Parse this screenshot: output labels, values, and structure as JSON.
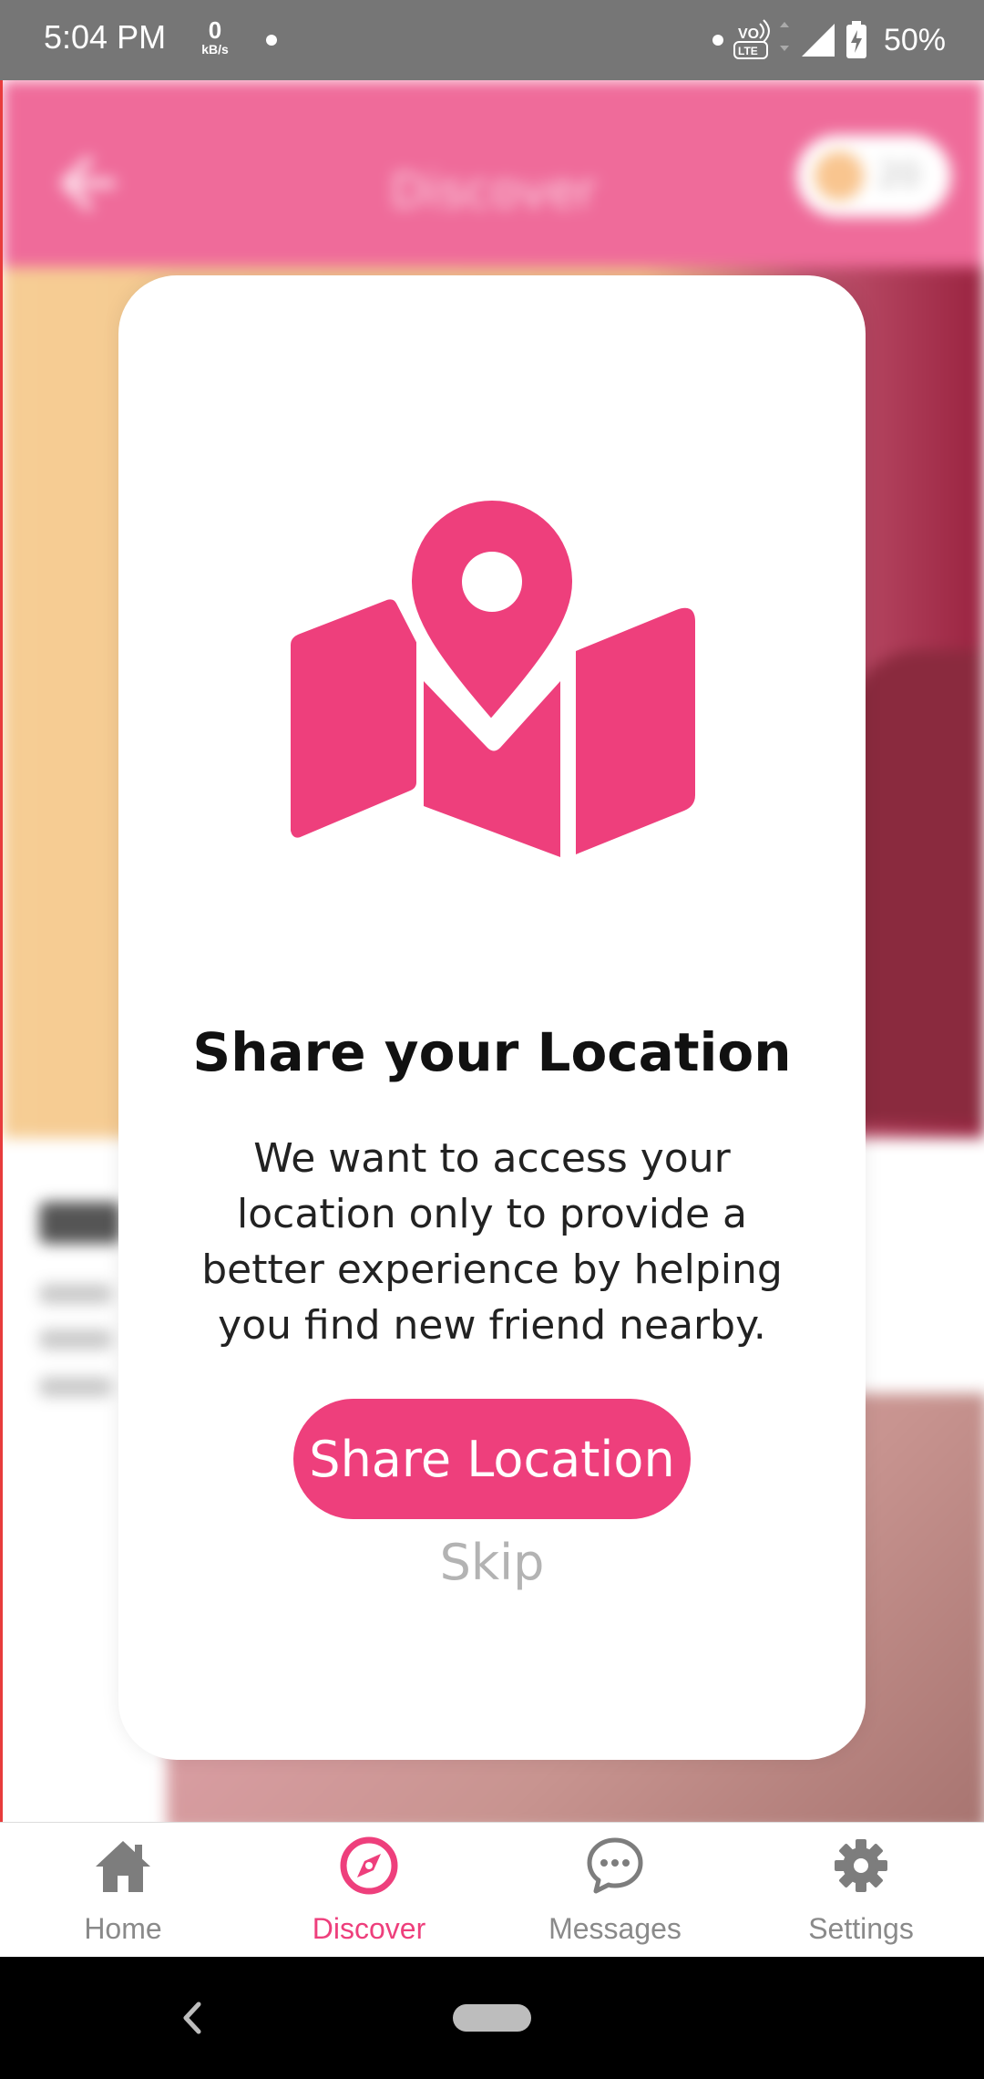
{
  "status_bar": {
    "time": "5:04 PM",
    "net_speed_value": "0",
    "net_speed_unit": "kB/s",
    "battery": "50%"
  },
  "header": {
    "title": "Discover",
    "coin_count": "20"
  },
  "dialog": {
    "title": "Share your Location",
    "body": "We want to access your location only to provide a better experience by helping you find new friend nearby.",
    "primary_button": "Share Location",
    "secondary_button": "Skip"
  },
  "bottom_nav": {
    "items": [
      {
        "label": "Home",
        "icon": "home-icon"
      },
      {
        "label": "Discover",
        "icon": "compass-icon",
        "active": true
      },
      {
        "label": "Messages",
        "icon": "chat-bubble-icon"
      },
      {
        "label": "Settings",
        "icon": "gear-icon"
      }
    ]
  },
  "colors": {
    "accent": "#ee3f7c",
    "header": "#ef6b9a",
    "status_bar": "#767676"
  }
}
